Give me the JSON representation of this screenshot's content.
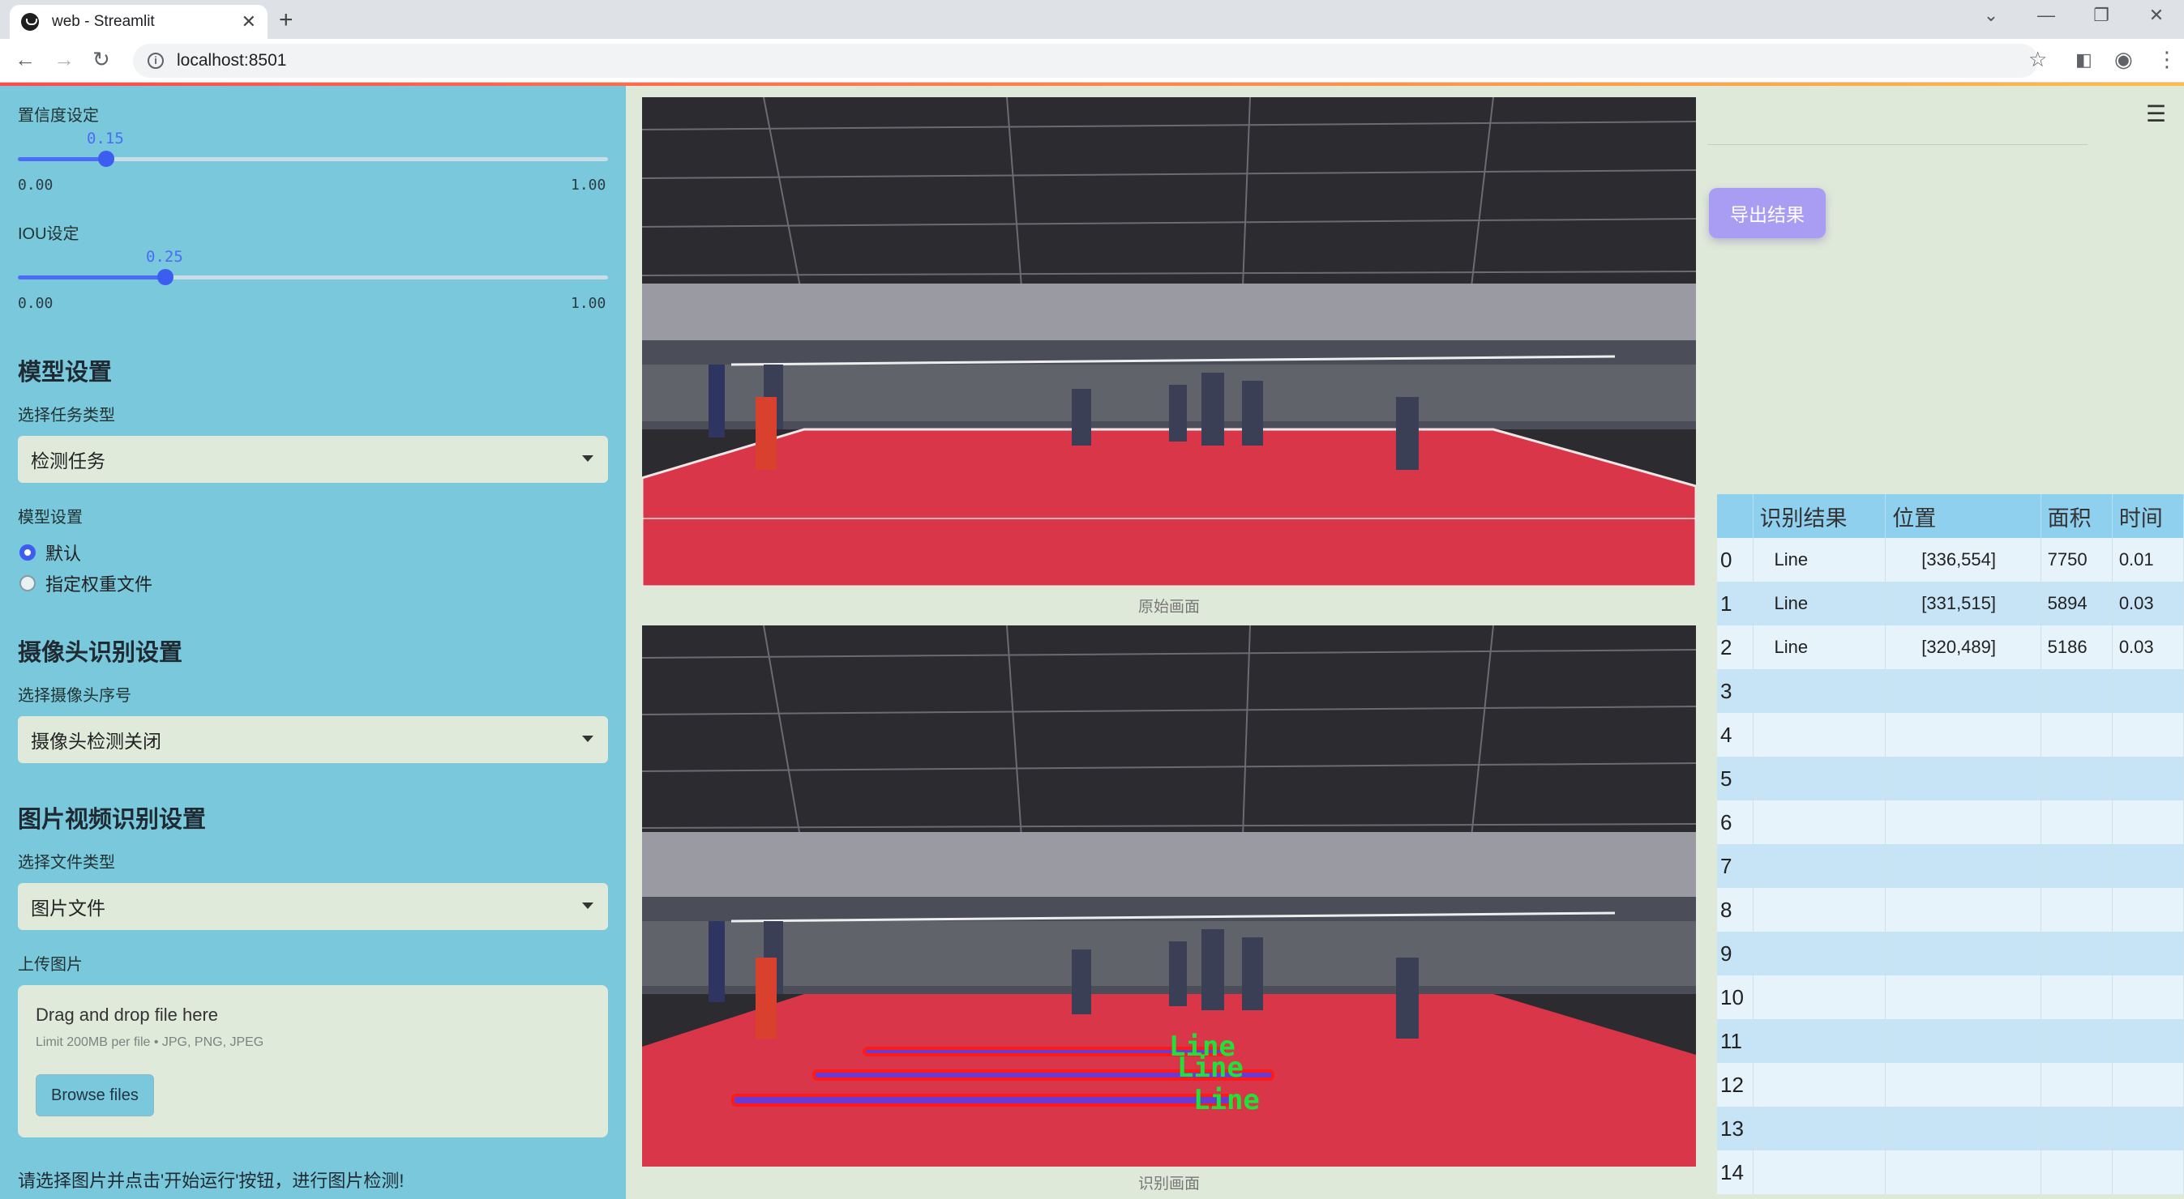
{
  "browser": {
    "tab_title": "web - Streamlit",
    "url": "localhost:8501",
    "new_tab": "+",
    "controls": [
      "⌄",
      "—",
      "❐",
      "✕"
    ]
  },
  "sidebar": {
    "confidence": {
      "label": "置信度设定",
      "value": "0.15",
      "min": "0.00",
      "max": "1.00",
      "level": 0.15
    },
    "iou": {
      "label": "IOU设定",
      "value": "0.25",
      "min": "0.00",
      "max": "1.00",
      "level": 0.25
    },
    "model_section": "模型设置",
    "task_type_label": "选择任务类型",
    "task_type_value": "检测任务",
    "model_label": "模型设置",
    "model_options": [
      "默认",
      "指定权重文件"
    ],
    "camera_section": "摄像头识别设置",
    "camera_label": "选择摄像头序号",
    "camera_value": "摄像头检测关闭",
    "file_section": "图片视频识别设置",
    "file_type_label": "选择文件类型",
    "file_type_value": "图片文件",
    "upload_label": "上传图片",
    "upload_title": "Drag and drop file here",
    "upload_limit": "Limit 200MB per file • JPG, PNG, JPEG",
    "browse_button": "Browse files",
    "note": "请选择图片并点击'开始运行'按钮，进行图片检测!"
  },
  "main": {
    "original_caption": "原始画面",
    "result_caption": "识别画面",
    "detection_labels": [
      "Line",
      "Line",
      "Line"
    ],
    "export_button": "导出结果",
    "table": {
      "headers": [
        "",
        "识别结果",
        "位置",
        "面积",
        "时间"
      ],
      "rows": [
        {
          "idx": "0",
          "result": "Line",
          "pos": "[336,554]",
          "area": "7750",
          "time": "0.01"
        },
        {
          "idx": "1",
          "result": "Line",
          "pos": "[331,515]",
          "area": "5894",
          "time": "0.03"
        },
        {
          "idx": "2",
          "result": "Line",
          "pos": "[320,489]",
          "area": "5186",
          "time": "0.03"
        },
        {
          "idx": "3",
          "result": "",
          "pos": "",
          "area": "",
          "time": ""
        },
        {
          "idx": "4",
          "result": "",
          "pos": "",
          "area": "",
          "time": ""
        },
        {
          "idx": "5",
          "result": "",
          "pos": "",
          "area": "",
          "time": ""
        },
        {
          "idx": "6",
          "result": "",
          "pos": "",
          "area": "",
          "time": ""
        },
        {
          "idx": "7",
          "result": "",
          "pos": "",
          "area": "",
          "time": ""
        },
        {
          "idx": "8",
          "result": "",
          "pos": "",
          "area": "",
          "time": ""
        },
        {
          "idx": "9",
          "result": "",
          "pos": "",
          "area": "",
          "time": ""
        },
        {
          "idx": "10",
          "result": "",
          "pos": "",
          "area": "",
          "time": ""
        },
        {
          "idx": "11",
          "result": "",
          "pos": "",
          "area": "",
          "time": ""
        },
        {
          "idx": "12",
          "result": "",
          "pos": "",
          "area": "",
          "time": ""
        },
        {
          "idx": "13",
          "result": "",
          "pos": "",
          "area": "",
          "time": ""
        },
        {
          "idx": "14",
          "result": "",
          "pos": "",
          "area": "",
          "time": ""
        }
      ]
    }
  },
  "colors": {
    "sidebar_bg": "#79c8dc",
    "main_bg": "#dfe9d9",
    "slider_accent": "#3d5df0",
    "export_button": "#a99cf3",
    "table_header": "#8fd0ee",
    "detection_box": "#ff1a1a",
    "detection_label": "#22e03a"
  }
}
